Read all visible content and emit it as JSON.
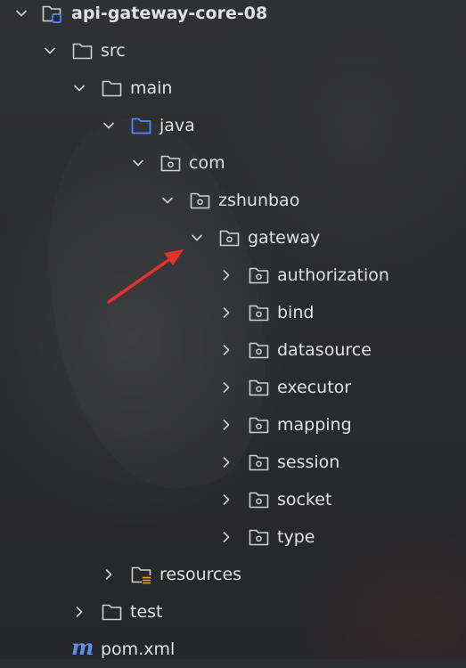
{
  "project_tree": {
    "root": {
      "label": "api-gateway-core-08",
      "icon": "project-module-icon"
    },
    "items": [
      {
        "label": "src",
        "icon": "folder-icon",
        "chevron": "expanded"
      },
      {
        "label": "main",
        "icon": "folder-icon",
        "chevron": "expanded"
      },
      {
        "label": "java",
        "icon": "source-folder-icon",
        "chevron": "expanded"
      },
      {
        "label": "com",
        "icon": "package-icon",
        "chevron": "expanded"
      },
      {
        "label": "zshunbao",
        "icon": "package-icon",
        "chevron": "expanded"
      },
      {
        "label": "gateway",
        "icon": "package-icon",
        "chevron": "expanded"
      },
      {
        "label": "authorization",
        "icon": "package-icon",
        "chevron": "collapsed"
      },
      {
        "label": "bind",
        "icon": "package-icon",
        "chevron": "collapsed"
      },
      {
        "label": "datasource",
        "icon": "package-icon",
        "chevron": "collapsed"
      },
      {
        "label": "executor",
        "icon": "package-icon",
        "chevron": "collapsed"
      },
      {
        "label": "mapping",
        "icon": "package-icon",
        "chevron": "collapsed"
      },
      {
        "label": "session",
        "icon": "package-icon",
        "chevron": "collapsed"
      },
      {
        "label": "socket",
        "icon": "package-icon",
        "chevron": "collapsed"
      },
      {
        "label": "type",
        "icon": "package-icon",
        "chevron": "collapsed"
      },
      {
        "label": "resources",
        "icon": "resources-folder-icon",
        "chevron": "collapsed"
      },
      {
        "label": "test",
        "icon": "folder-icon",
        "chevron": "collapsed"
      },
      {
        "label": "pom.xml",
        "icon": "maven-icon",
        "chevron": "none"
      }
    ]
  },
  "colors": {
    "background": "#2b2d30",
    "text": "#dfe1e5",
    "icon_stroke": "#ced0d6",
    "source_folder": "#548af7",
    "resources_marker": "#d9a343",
    "maven": "#5c8ff0",
    "annotation_arrow": "#e5322d"
  }
}
